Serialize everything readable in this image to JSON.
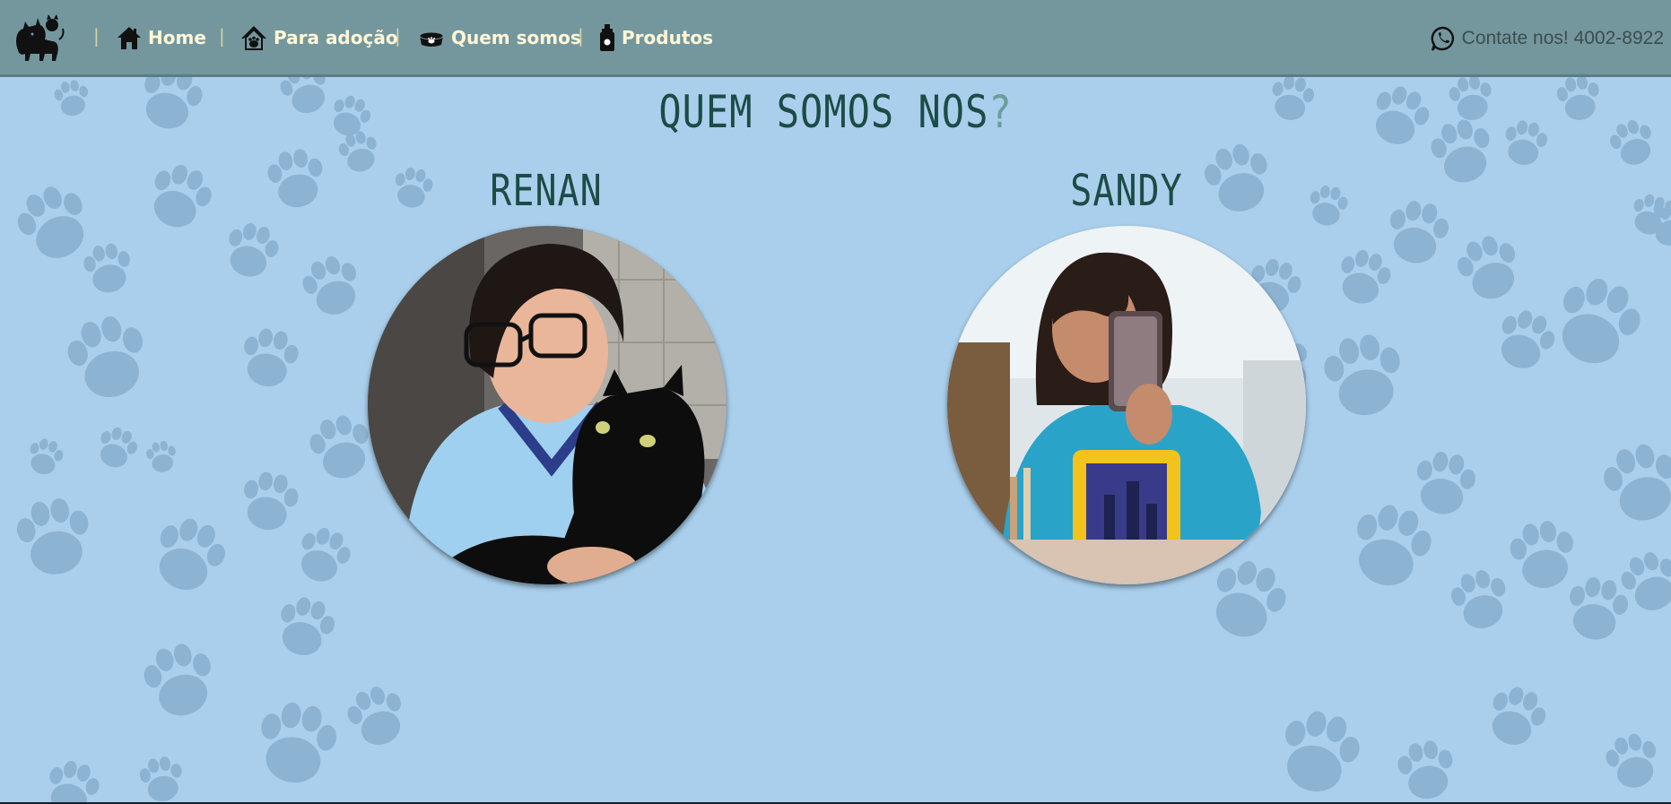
{
  "nav": {
    "home": "Home",
    "adoption": "Para adoção",
    "about": "Quem somos",
    "products": "Produtos",
    "separator": "|",
    "contact": "Contate nos! 4002-8922"
  },
  "page": {
    "title": "QUEM SOMOS NOS",
    "title_mark": "?"
  },
  "members": [
    {
      "name": "RENAN"
    },
    {
      "name": "SANDY"
    }
  ],
  "colors": {
    "background": "#a9cfec",
    "navbar": "#74979e",
    "nav_text": "#fff6d6",
    "title": "#1c4c46",
    "paw": "#7ea5c4"
  },
  "icons": {
    "logo": "dog-cat-logo-icon",
    "home": "house-icon",
    "adoption": "pet-house-icon",
    "about": "pet-bowl-icon",
    "products": "pet-bottle-icon",
    "contact": "whatsapp-icon"
  }
}
